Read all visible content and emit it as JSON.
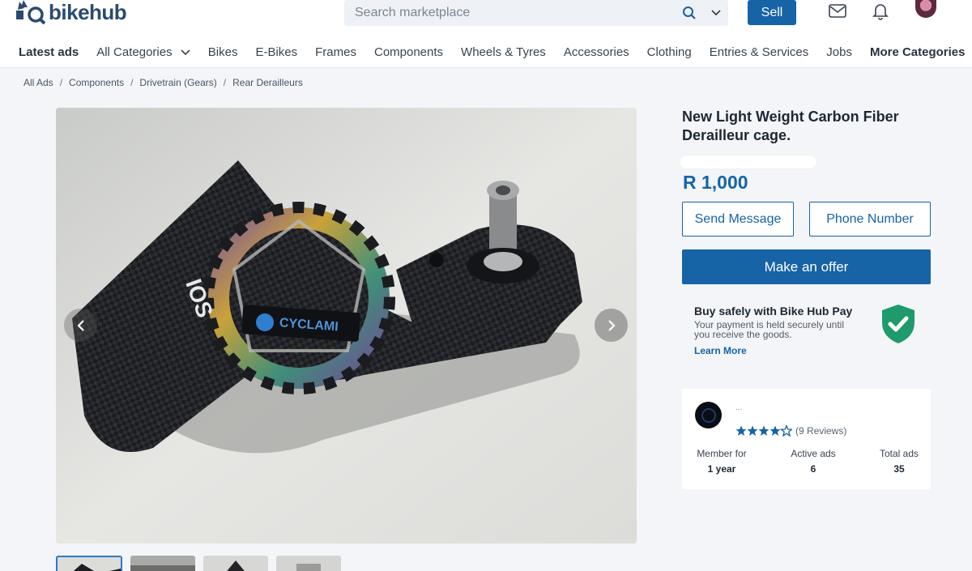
{
  "brand": {
    "name": "bikehub",
    "accent": "#1663a6"
  },
  "search": {
    "placeholder": "Search marketplace"
  },
  "header": {
    "sell_label": "Sell"
  },
  "nav": {
    "items": [
      "Latest ads",
      "All Categories",
      "Bikes",
      "E-Bikes",
      "Frames",
      "Components",
      "Wheels & Tyres",
      "Accessories",
      "Clothing",
      "Entries & Services",
      "Jobs",
      "More Categories"
    ]
  },
  "breadcrumb": [
    "All Ads",
    "Components",
    "Drivetrain (Gears)",
    "Rear Derailleurs"
  ],
  "listing": {
    "title": "New Light Weight Carbon Fiber Derailleur cage.",
    "price": "R 1,000",
    "image_brand_text": "CYCLAMI",
    "image_sub_text": "IOS"
  },
  "actions": {
    "send_message": "Send Message",
    "phone_number": "Phone Number",
    "make_offer": "Make an offer"
  },
  "safe_pay": {
    "title": "Buy safely with Bike Hub Pay",
    "text": "Your payment is held securely until you receive the goods.",
    "link": "Learn More"
  },
  "seller": {
    "name": "...",
    "rating": 4.5,
    "reviews": "(9 Reviews)",
    "stats": [
      {
        "label": "Member for",
        "value": "1 year"
      },
      {
        "label": "Active ads",
        "value": "6"
      },
      {
        "label": "Total ads",
        "value": "35"
      }
    ]
  }
}
